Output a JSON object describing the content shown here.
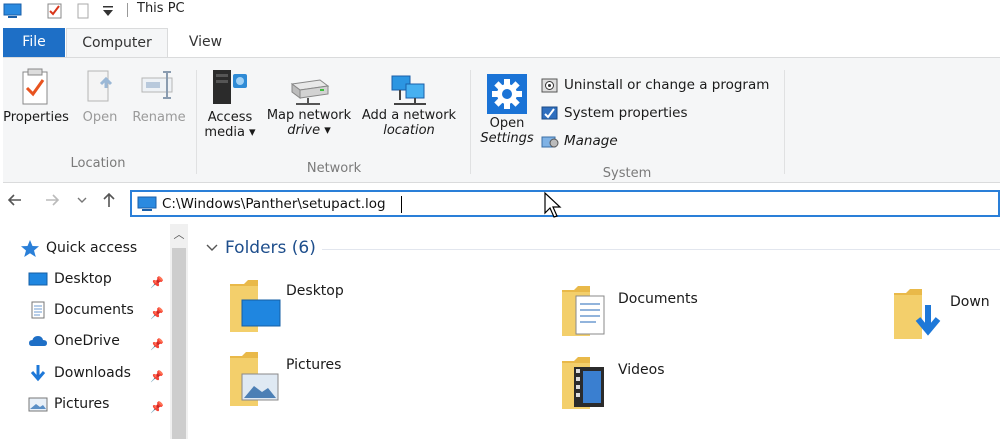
{
  "window": {
    "title": "This PC"
  },
  "tabs": {
    "file": "File",
    "computer": "Computer",
    "view": "View"
  },
  "ribbon": {
    "location": {
      "label": "Location",
      "properties": "Properties",
      "open": "Open",
      "rename": "Rename"
    },
    "network": {
      "label": "Network",
      "access_media_1": "Access",
      "access_media_2": "media ▾",
      "map_drive_1": "Map network",
      "map_drive_2": "drive ▾",
      "add_location_1": "Add a network",
      "add_location_2": "location"
    },
    "system": {
      "label": "System",
      "open_settings_1": "Open",
      "open_settings_2": "Settings",
      "uninstall": "Uninstall or change a program",
      "system_properties": "System properties",
      "manage": "Manage"
    }
  },
  "address": {
    "value": "C:\\Windows\\Panther\\setupact.log"
  },
  "nav_pane": {
    "items": [
      {
        "label": "Quick access"
      },
      {
        "label": "Desktop"
      },
      {
        "label": "Documents"
      },
      {
        "label": "OneDrive"
      },
      {
        "label": "Downloads"
      },
      {
        "label": "Pictures"
      }
    ]
  },
  "content": {
    "group_title": "Folders (6)",
    "folders": [
      {
        "label": "Desktop"
      },
      {
        "label": "Documents"
      },
      {
        "label": "Down"
      },
      {
        "label": "Pictures"
      },
      {
        "label": "Videos"
      }
    ]
  },
  "colors": {
    "accent": "#1e6fc6",
    "folder": "#f3cf6b",
    "header_text": "#1e4e8c"
  }
}
